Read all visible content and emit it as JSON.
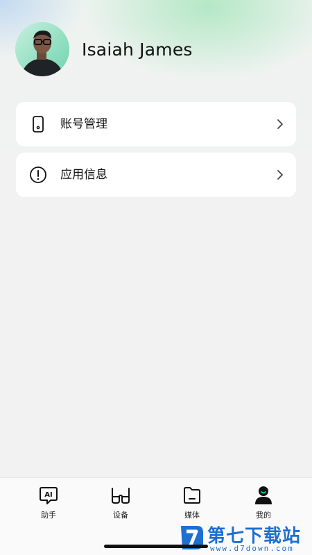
{
  "profile": {
    "name": "Isaiah James"
  },
  "menu": {
    "items": [
      {
        "label": "账号管理",
        "icon": "phone-icon"
      },
      {
        "label": "应用信息",
        "icon": "info-circle-icon"
      }
    ]
  },
  "tabbar": {
    "items": [
      {
        "label": "助手",
        "icon": "ai-chat-icon"
      },
      {
        "label": "设备",
        "icon": "glasses-icon"
      },
      {
        "label": "媒体",
        "icon": "folder-icon"
      },
      {
        "label": "我的",
        "icon": "person-icon",
        "active": true
      }
    ]
  },
  "watermark": {
    "title": "第七下载站",
    "url": "www.d7down.com"
  },
  "colors": {
    "accent": "#2ad08a",
    "watermark": "#1d6fd0"
  }
}
